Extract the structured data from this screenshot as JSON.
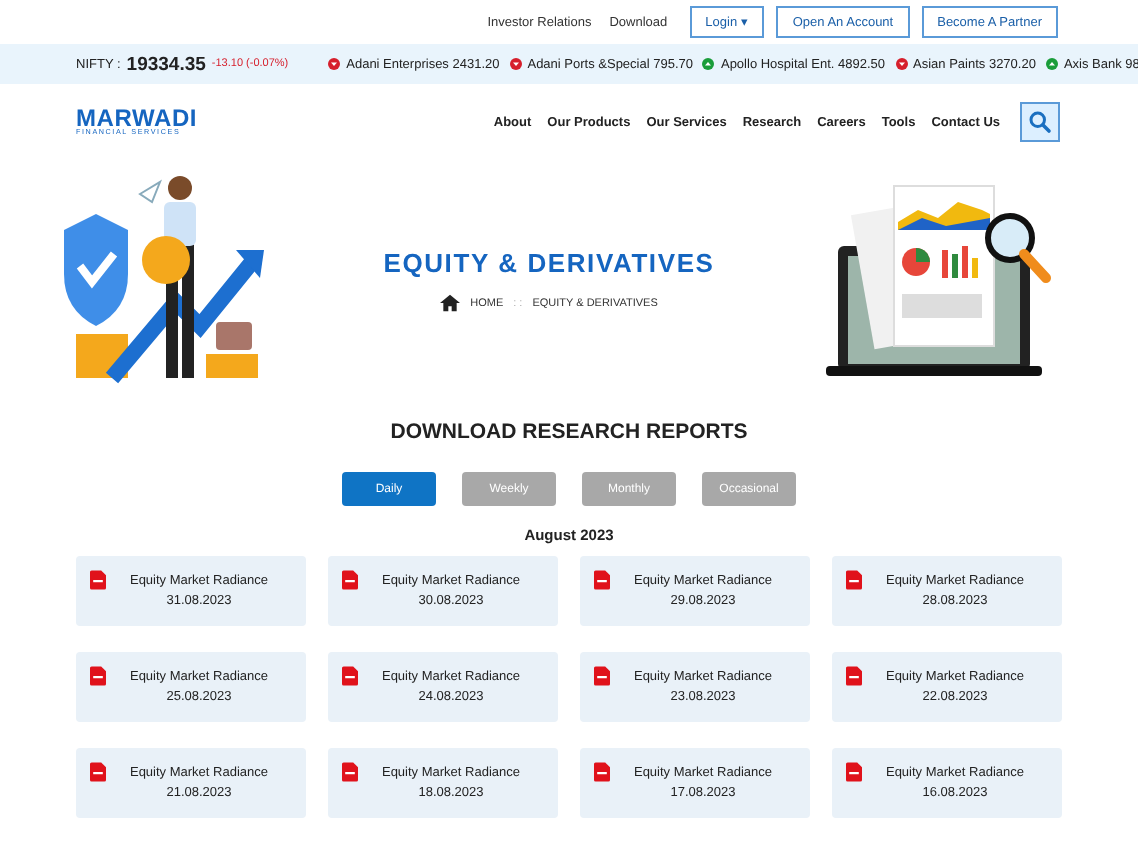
{
  "top_links": [
    "Investor Relations",
    "Download"
  ],
  "login_button": "Login ▾",
  "top_buttons": [
    "Open An Account",
    "Become A Partner"
  ],
  "ticker": {
    "index_label": "NIFTY :",
    "index_value": "19334.35",
    "index_change": "-13.10 (-0.07%)",
    "stocks": [
      {
        "text": "Adani Enterprises 2431.20",
        "rising": false
      },
      {
        "text": "Adani Ports &Special 795.70",
        "rising": false
      },
      {
        "text": "Apollo Hospital Ent. 4892.50",
        "rising": true
      },
      {
        "text": "Asian Paints 3270.20",
        "rising": false
      },
      {
        "text": "Axis Bank 98",
        "rising": true
      }
    ]
  },
  "logo": {
    "name": "MARWADI",
    "tagline": "FINANCIAL SERVICES"
  },
  "nav": [
    "About",
    "Our Products",
    "Our Services",
    "Research",
    "Careers",
    "Tools",
    "Contact Us"
  ],
  "hero": {
    "title": "EQUITY & DERIVATIVES",
    "breadcrumb": [
      "HOME",
      "EQUITY & DERIVATIVES"
    ],
    "separator": ": :"
  },
  "section_title": "DOWNLOAD RESEARCH REPORTS",
  "tabs": [
    {
      "label": "Daily",
      "selected": true
    },
    {
      "label": "Weekly",
      "selected": false
    },
    {
      "label": "Monthly",
      "selected": false
    },
    {
      "label": "Occasional",
      "selected": false
    }
  ],
  "month": "August 2023",
  "reports": [
    {
      "title": "Equity Market Radiance",
      "date": "31.08.2023"
    },
    {
      "title": "Equity Market Radiance",
      "date": "30.08.2023"
    },
    {
      "title": "Equity Market Radiance",
      "date": "29.08.2023"
    },
    {
      "title": "Equity Market Radiance",
      "date": "28.08.2023"
    },
    {
      "title": "Equity Market Radiance",
      "date": "25.08.2023"
    },
    {
      "title": "Equity Market Radiance",
      "date": "24.08.2023"
    },
    {
      "title": "Equity Market Radiance",
      "date": "23.08.2023"
    },
    {
      "title": "Equity Market Radiance",
      "date": "22.08.2023"
    },
    {
      "title": "Equity Market Radiance",
      "date": "21.08.2023"
    },
    {
      "title": "Equity Market Radiance",
      "date": "18.08.2023"
    },
    {
      "title": "Equity Market Radiance",
      "date": "17.08.2023"
    },
    {
      "title": "Equity Market Radiance",
      "date": "16.08.2023"
    }
  ]
}
